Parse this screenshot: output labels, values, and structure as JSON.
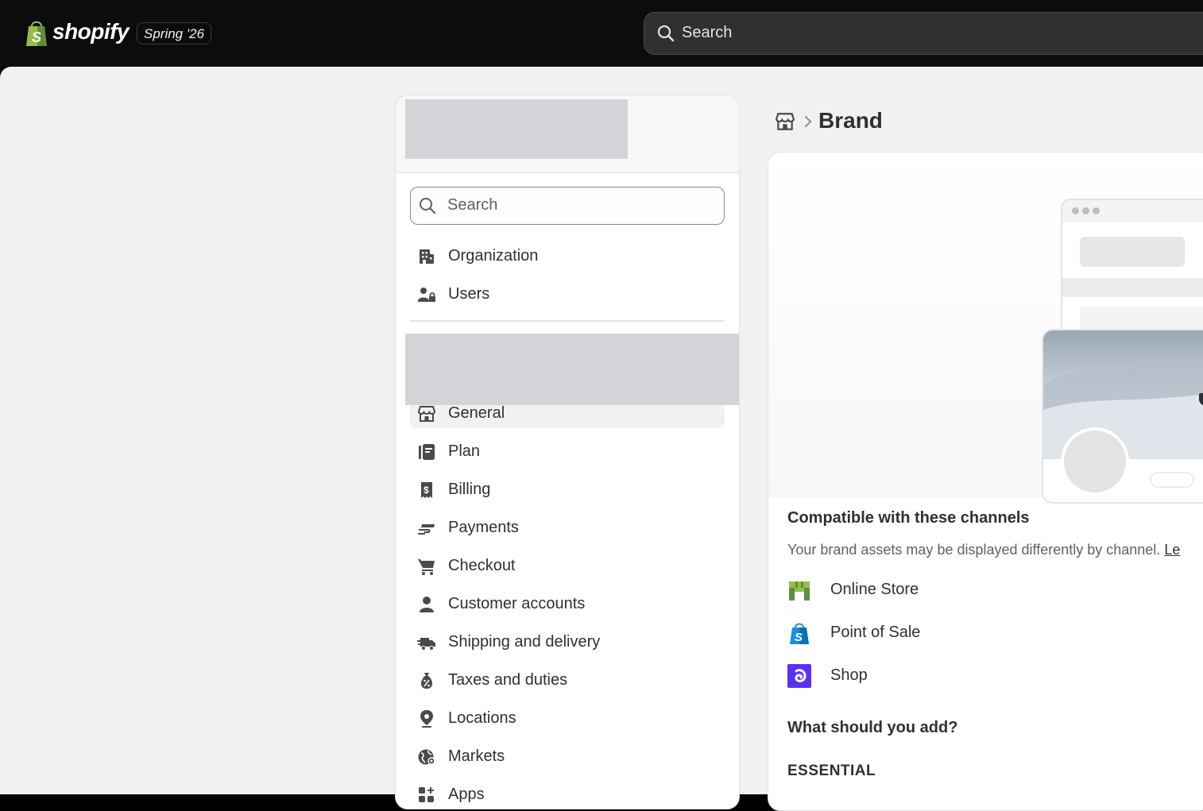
{
  "topbar": {
    "logo_text": "shopify",
    "edition_badge": "Spring '26",
    "search_placeholder": "Search"
  },
  "settings": {
    "search_placeholder": "Search",
    "items_top": [
      {
        "label": "Organization",
        "icon": "building-icon"
      },
      {
        "label": "Users",
        "icon": "users-icon"
      }
    ],
    "items_store": [
      {
        "label": "General",
        "icon": "store-icon",
        "selected": true
      },
      {
        "label": "Plan",
        "icon": "plan-icon"
      },
      {
        "label": "Billing",
        "icon": "billing-icon"
      },
      {
        "label": "Payments",
        "icon": "payments-icon"
      },
      {
        "label": "Checkout",
        "icon": "cart-icon"
      },
      {
        "label": "Customer accounts",
        "icon": "person-icon"
      },
      {
        "label": "Shipping and delivery",
        "icon": "truck-icon"
      },
      {
        "label": "Taxes and duties",
        "icon": "tax-icon"
      },
      {
        "label": "Locations",
        "icon": "location-icon"
      },
      {
        "label": "Markets",
        "icon": "globe-icon"
      },
      {
        "label": "Apps",
        "icon": "apps-icon"
      }
    ]
  },
  "main": {
    "breadcrumb_title": "Brand",
    "compatible_title": "Compatible with these channels",
    "compatible_sub": "Your brand assets may be displayed differently by channel.",
    "compatible_link": "Le",
    "channels": [
      {
        "label": "Online Store",
        "icon": "online-store-icon"
      },
      {
        "label": "Point of Sale",
        "icon": "point-of-sale-icon"
      },
      {
        "label": "Shop",
        "icon": "shop-icon"
      }
    ],
    "what_title": "What should you add?",
    "essential_label": "ESSENTIAL"
  },
  "colors": {
    "topbar_bg": "#0c0c0c",
    "canvas_bg": "#f1f1f1",
    "shopify_green": "#95bf47",
    "pos_blue": "#1a8fe3",
    "shop_purple": "#5a31f4"
  }
}
